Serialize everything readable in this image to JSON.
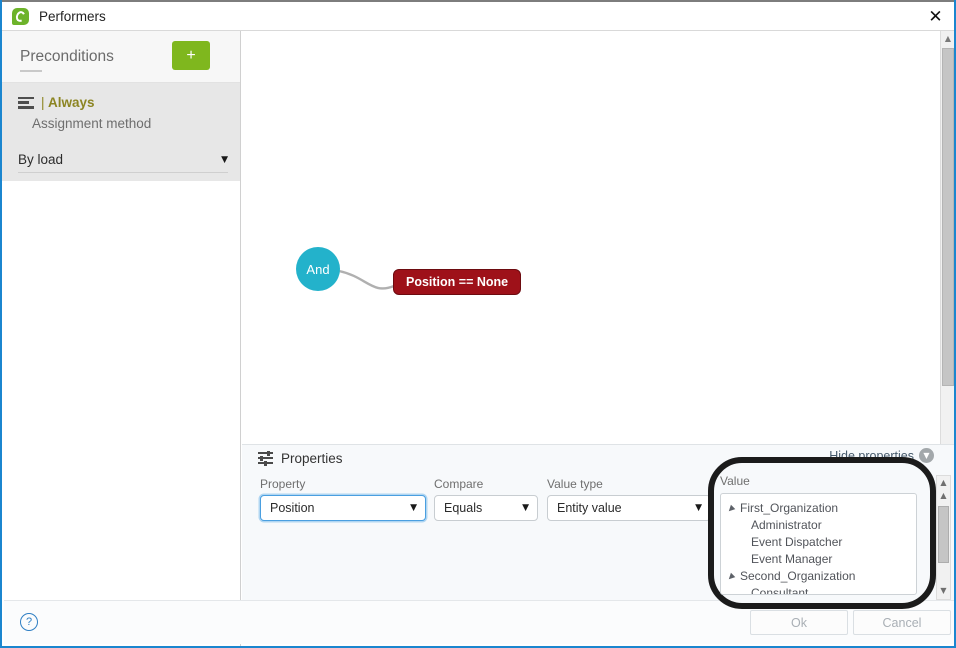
{
  "window": {
    "title": "Performers",
    "logo_icon": "app-logo-icon",
    "close_icon": "close-icon",
    "accent_color": "#1b86cf"
  },
  "sidebar": {
    "tab_label": "Preconditions",
    "add_button_label": "+",
    "add_button_color": "#7fb71e",
    "precondition": {
      "list_icon": "list-icon",
      "name": "Always",
      "name_color": "#8c8523",
      "assignment_method_label": "Assignment method",
      "assignment_method_value": "By load",
      "caret_icon": "chevron-down-icon"
    }
  },
  "canvas": {
    "nodes": [
      {
        "id": "and",
        "label": "And",
        "type": "operator",
        "color": "#23b2cb"
      },
      {
        "id": "condition",
        "label": "Position == None",
        "type": "condition",
        "color": "#9e1119"
      }
    ],
    "connector_color": "#b0b0b0",
    "scroll_up_icon": "scroll-up-icon"
  },
  "properties": {
    "icon": "sliders-icon",
    "title": "Properties",
    "hide_label": "Hide properties",
    "hide_icon": "chevron-down-circle-icon",
    "fields": [
      {
        "name": "property",
        "label": "Property",
        "value": "Position",
        "caret_icon": "chevron-down-icon",
        "focused": true
      },
      {
        "name": "compare",
        "label": "Compare",
        "value": "Equals",
        "caret_icon": "chevron-down-icon",
        "focused": false
      },
      {
        "name": "value_type",
        "label": "Value type",
        "value": "Entity value",
        "caret_icon": "chevron-down-icon",
        "focused": false
      }
    ],
    "value_field": {
      "label": "Value",
      "tree": [
        {
          "label": "First_Organization",
          "level": 0,
          "expanded": true,
          "caret_icon": "expanded-triangle-icon"
        },
        {
          "label": "Administrator",
          "level": 1,
          "expanded": false,
          "caret_icon": ""
        },
        {
          "label": "Event Dispatcher",
          "level": 1,
          "expanded": false,
          "caret_icon": ""
        },
        {
          "label": "Event Manager",
          "level": 1,
          "expanded": false,
          "caret_icon": ""
        },
        {
          "label": "Second_Organization",
          "level": 0,
          "expanded": true,
          "caret_icon": "expanded-triangle-icon"
        },
        {
          "label": "Consultant",
          "level": 1,
          "expanded": false,
          "caret_icon": ""
        }
      ],
      "scroll_up_icon": "scroll-up-icon",
      "scroll_down_icon": "scroll-down-icon"
    }
  },
  "footer": {
    "help_icon": "help-icon",
    "help_label": "?",
    "ok_label": "Ok",
    "cancel_label": "Cancel",
    "buttons_disabled": true
  }
}
